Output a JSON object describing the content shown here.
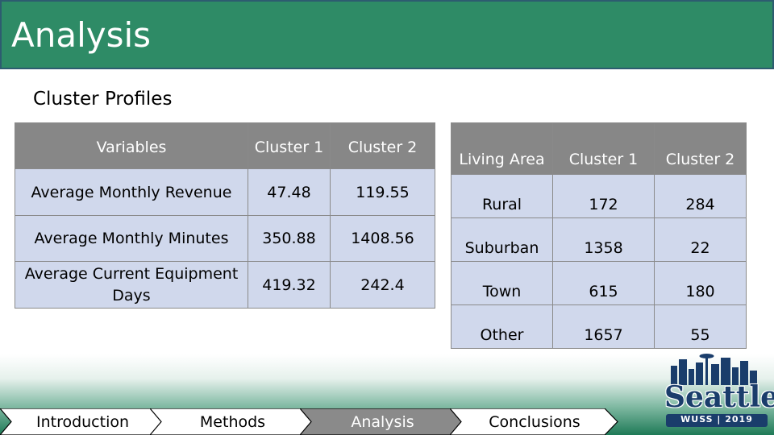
{
  "header": {
    "title": "Analysis",
    "bg_color": "#2e8b66"
  },
  "subtitle": "Cluster Profiles",
  "variables_table": {
    "headers": [
      "Variables",
      "Cluster 1",
      "Cluster 2"
    ],
    "rows": [
      [
        "Average Monthly Revenue",
        "47.48",
        "119.55"
      ],
      [
        "Average Monthly Minutes",
        "350.88",
        "1408.56"
      ],
      [
        "Average Current Equipment Days",
        "419.32",
        "242.4"
      ]
    ]
  },
  "living_area_table": {
    "headers": [
      "Living Area",
      "Cluster 1",
      "Cluster 2"
    ],
    "rows": [
      [
        "Rural",
        "172",
        "284"
      ],
      [
        "Suburban",
        "1358",
        "22"
      ],
      [
        "Town",
        "615",
        "180"
      ],
      [
        "Other",
        "1657",
        "55"
      ]
    ]
  },
  "nav": {
    "items": [
      {
        "label": "Introduction",
        "active": false
      },
      {
        "label": "Methods",
        "active": false
      },
      {
        "label": "Analysis",
        "active": true
      },
      {
        "label": "Conclusions",
        "active": false
      }
    ]
  },
  "logo": {
    "word": "Seattle",
    "subtext": "WUSS | 2019",
    "icon": "seattle-skyline-icon"
  }
}
